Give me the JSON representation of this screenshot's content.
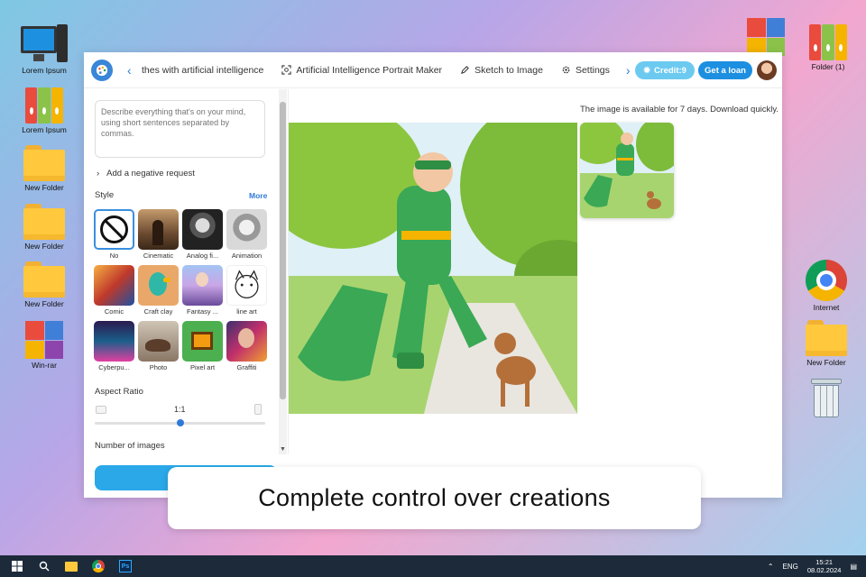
{
  "desktop": {
    "left_icons": [
      {
        "label": "Lorem Ipsum",
        "icon": "computer-icon"
      },
      {
        "label": "Lorem Ipsum",
        "icon": "binders-icon"
      },
      {
        "label": "New Folder",
        "icon": "folder-icon"
      },
      {
        "label": "New Folder",
        "icon": "folder-icon"
      },
      {
        "label": "New Folder",
        "icon": "folder-icon"
      },
      {
        "label": "Win-rar",
        "icon": "winrar-icon"
      }
    ],
    "right_icons": [
      {
        "label": "",
        "icon": "binders-icon"
      },
      {
        "label": "Folder (1)",
        "icon": "binders-icon"
      },
      {
        "label": "Internet",
        "icon": "chrome-icon"
      },
      {
        "label": "New Folder",
        "icon": "folder-icon"
      },
      {
        "label": "",
        "icon": "trash-icon"
      }
    ]
  },
  "app": {
    "nav": {
      "item1": "thes with artificial intelligence",
      "item2": "Artificial Intelligence Portrait Maker",
      "item3": "Sketch to Image",
      "item4": "Settings"
    },
    "credit_label": "Credit:9",
    "loan_label": "Get a loan",
    "sidebar": {
      "prompt_placeholder": "Describe everything that's on your mind, using short sentences separated by commas.",
      "negative_request": "Add a negative request",
      "style_heading": "Style",
      "more_label": "More",
      "styles": [
        {
          "label": "No"
        },
        {
          "label": "Cinematic"
        },
        {
          "label": "Analog fi..."
        },
        {
          "label": "Animation"
        },
        {
          "label": "Comic"
        },
        {
          "label": "Craft clay"
        },
        {
          "label": "Fantasy ..."
        },
        {
          "label": "line art"
        },
        {
          "label": "Cyberpu..."
        },
        {
          "label": "Photo"
        },
        {
          "label": "Pixel art"
        },
        {
          "label": "Graffiti"
        }
      ],
      "aspect_heading": "Aspect Ratio",
      "aspect_value": "1:1",
      "aspect_slider_fraction": 0.5,
      "num_images_heading": "Number of images"
    },
    "notice": "The image is available for 7 days. Download quickly."
  },
  "banner": "Complete control over creations",
  "taskbar": {
    "language": "ENG",
    "time": "15:21",
    "date": "08.02.2024"
  },
  "colors": {
    "accent": "#2f7ad8",
    "credit_bg": "#6ccaf0",
    "loan_bg": "#1d8fe1"
  }
}
